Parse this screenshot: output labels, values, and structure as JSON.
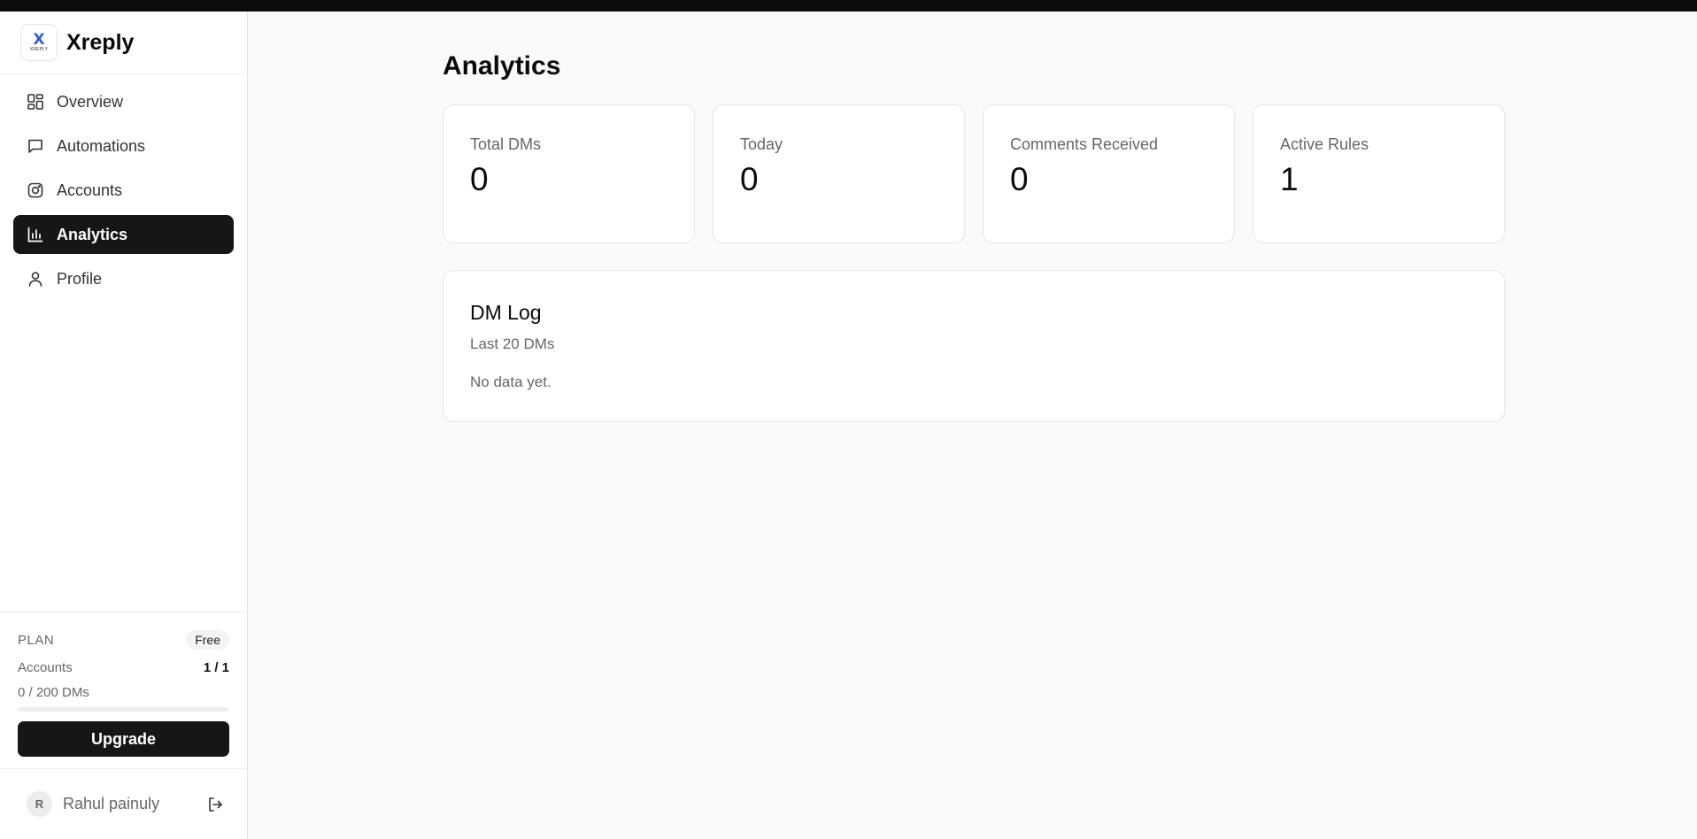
{
  "brand": {
    "name": "Xreply",
    "logo_letter": "X",
    "logo_subtext": "XREPLY"
  },
  "sidebar": {
    "items": [
      {
        "label": "Overview",
        "icon": "dashboard-grid-icon",
        "active": false
      },
      {
        "label": "Automations",
        "icon": "message-square-icon",
        "active": false
      },
      {
        "label": "Accounts",
        "icon": "instagram-icon",
        "active": false
      },
      {
        "label": "Analytics",
        "icon": "bar-chart-icon",
        "active": true
      },
      {
        "label": "Profile",
        "icon": "user-icon",
        "active": false
      }
    ]
  },
  "plan": {
    "label": "PLAN",
    "tier": "Free",
    "accounts_label": "Accounts",
    "accounts_value": "1 / 1",
    "dms_usage": "0 / 200 DMs",
    "dms_used_fraction": 0,
    "upgrade_label": "Upgrade"
  },
  "user": {
    "initial": "R",
    "name": "Rahul painuly"
  },
  "main": {
    "title": "Analytics",
    "stats": [
      {
        "label": "Total DMs",
        "value": "0"
      },
      {
        "label": "Today",
        "value": "0"
      },
      {
        "label": "Comments Received",
        "value": "0"
      },
      {
        "label": "Active Rules",
        "value": "1"
      }
    ],
    "dm_log": {
      "title": "DM Log",
      "subtitle": "Last 20 DMs",
      "empty_text": "No data yet."
    }
  },
  "colors": {
    "accent": "#161616",
    "background": "#fafafa",
    "card": "#ffffff",
    "muted_text": "#666666"
  }
}
